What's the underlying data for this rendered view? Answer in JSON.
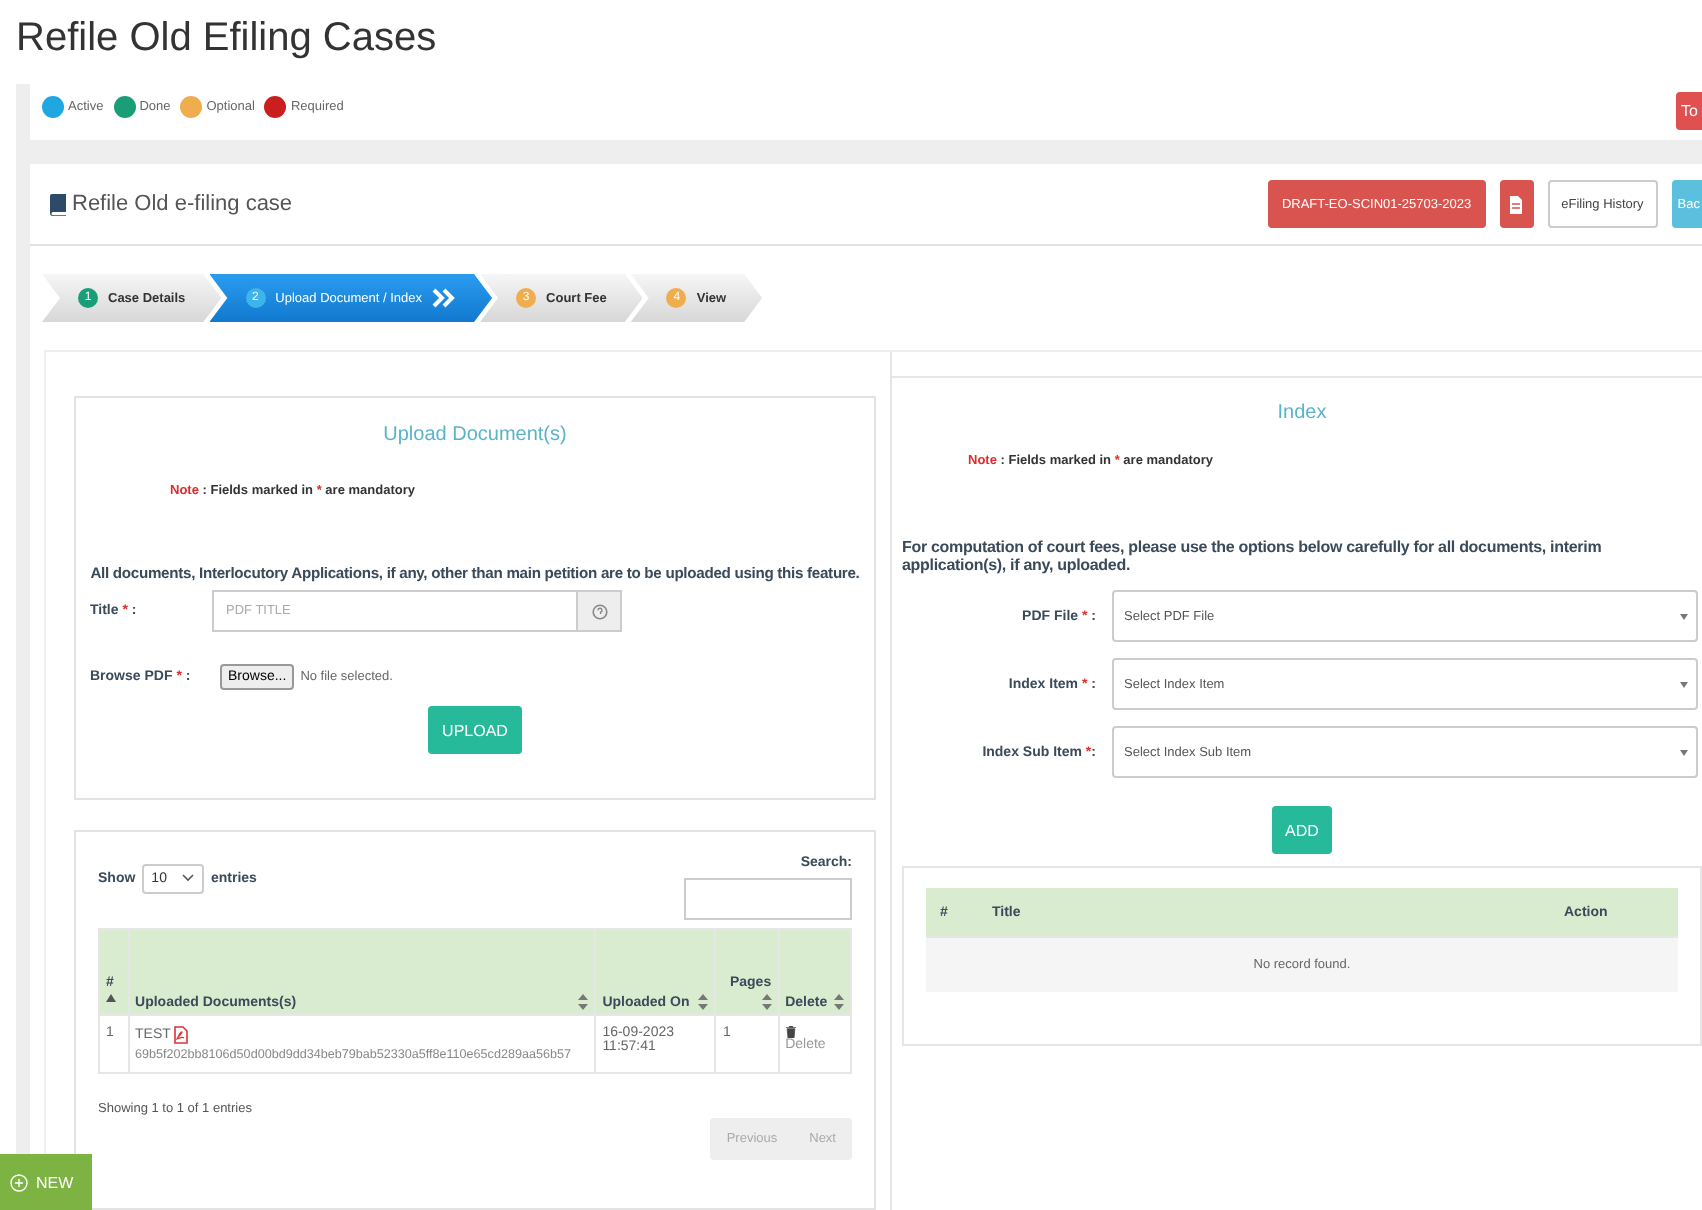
{
  "page_title": "Refile Old Efiling Cases",
  "legend": [
    {
      "label": "Active",
      "color": "#1ea7e1"
    },
    {
      "label": "Done",
      "color": "#1a9e78"
    },
    {
      "label": "Optional",
      "color": "#f0ad4e"
    },
    {
      "label": "Required",
      "color": "#c9201f"
    }
  ],
  "top_right_button": "To",
  "case_header": {
    "title": "Refile Old e-filing case",
    "draft_button": "DRAFT-EO-SCIN01-25703-2023",
    "history_button": "eFiling History",
    "back_button": "Bac"
  },
  "steps": [
    {
      "number": "1",
      "label": "Case Details",
      "selected": false,
      "color": "#1a9e78"
    },
    {
      "number": "2",
      "label": "Upload Document / Index",
      "selected": true,
      "color": "#3db4ea"
    },
    {
      "number": "3",
      "label": "Court Fee",
      "selected": false,
      "color": "#f0ad4e"
    },
    {
      "number": "4",
      "label": "View",
      "selected": false,
      "color": "#f0ad4e"
    }
  ],
  "upload": {
    "heading": "Upload Document(s)",
    "note": [
      {
        "text": "Note",
        "kind": "alert"
      },
      {
        "text": " : Fields marked in ",
        "kind": "plain"
      },
      {
        "text": "*",
        "kind": "alert"
      },
      {
        "text": " are mandatory",
        "kind": "plain"
      }
    ],
    "info": "All documents, Interlocutory Applications, if any, other than main petition are to be uploaded using this feature.",
    "title_label": [
      {
        "text": "Title ",
        "kind": "plain"
      },
      {
        "text": "*",
        "kind": "alert"
      },
      {
        "text": " :",
        "kind": "plain"
      }
    ],
    "title_placeholder": "PDF TITLE",
    "browse_label": [
      {
        "text": "Browse PDF ",
        "kind": "plain"
      },
      {
        "text": "*",
        "kind": "alert"
      },
      {
        "text": " :",
        "kind": "plain"
      }
    ],
    "browse_button": "Browse...",
    "file_status": "No file selected.",
    "upload_button": "UPLOAD"
  },
  "documents": {
    "show_label": "Show",
    "page_size": "10",
    "entries_label": "entries",
    "search_label": "Search:",
    "columns": [
      {
        "label": "#",
        "kind": "ascending"
      },
      {
        "label": "Uploaded Documents(s)",
        "kind": "sortable"
      },
      {
        "label": "Uploaded On",
        "kind": "sortable"
      },
      {
        "label": "Pages",
        "kind": "sortable"
      },
      {
        "label": "Delete",
        "kind": "sortable"
      }
    ],
    "rows": [
      {
        "number": "1",
        "title": "TEST",
        "hash": "69b5f202bb8106d50d00bd9dd34beb79bab52330a5ff8e110e65cd289aa56b57",
        "uploaded_on": "16-09-2023 11:57:41",
        "pages": "1",
        "delete": "Delete"
      }
    ],
    "info": "Showing 1 to 1 of 1 entries",
    "pagination": [
      {
        "label": "Previous",
        "disabled": true
      },
      {
        "label": "Next",
        "disabled": true
      }
    ]
  },
  "index": {
    "heading": "Index",
    "note": [
      {
        "text": "Note",
        "kind": "alert"
      },
      {
        "text": " : Fields marked in ",
        "kind": "plain"
      },
      {
        "text": "*",
        "kind": "alert"
      },
      {
        "text": " are mandatory",
        "kind": "plain"
      }
    ],
    "info": "For computation of court fees, please use the options below carefully for all documents, interim application(s), if any, uploaded.",
    "selects": [
      {
        "label": [
          {
            "text": "PDF File ",
            "kind": "plain"
          },
          {
            "text": "*",
            "kind": "alert"
          },
          {
            "text": " :",
            "kind": "plain"
          }
        ],
        "placeholder": "Select PDF File"
      },
      {
        "label": [
          {
            "text": "Index Item ",
            "kind": "plain"
          },
          {
            "text": "*",
            "kind": "alert"
          },
          {
            "text": " :",
            "kind": "plain"
          }
        ],
        "placeholder": "Select Index Item"
      },
      {
        "label": [
          {
            "text": "Index Sub Item ",
            "kind": "plain"
          },
          {
            "text": "*",
            "kind": "alert"
          },
          {
            "text": ":",
            "kind": "plain"
          }
        ],
        "placeholder": "Select Index Sub Item"
      }
    ],
    "add_button": "ADD",
    "columns": [
      "#",
      "Title",
      "Action"
    ],
    "empty_message": "No record found."
  },
  "new_button": "NEW"
}
